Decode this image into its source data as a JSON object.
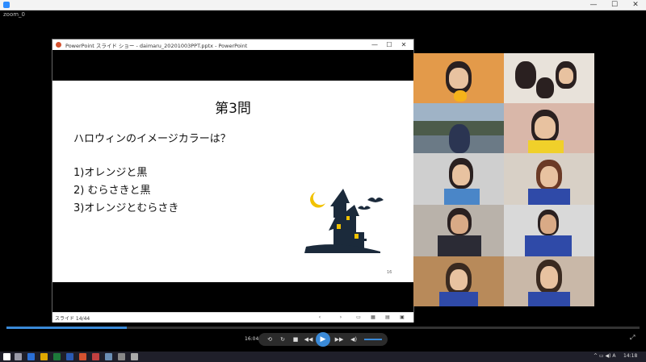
{
  "app": {
    "window_title": "zoom_0",
    "minimize": "—",
    "maximize": "☐",
    "close": "✕"
  },
  "ppt": {
    "title": "PowerPoint スライド ショー  -  daimaru_20201003PPT.pptx - PowerPoint",
    "status": "スライド 14/44"
  },
  "slide": {
    "title": "第3問",
    "question": "ハロウィンのイメージカラーは？",
    "options": [
      "1)オレンジと黒",
      "2) むらさきと黒",
      "3)オレンジとむらさき"
    ],
    "page_number": "16"
  },
  "player": {
    "time": "16:04",
    "progress": 0.19,
    "controls": {
      "repeat": "⟲",
      "rotate": "↻",
      "stop": "■",
      "prev": "◀◀",
      "play": "▶",
      "next": "▶▶",
      "volume": "◀)"
    },
    "fullscreen": "⤢"
  },
  "taskbar": {
    "clock": "14:18",
    "tray": "^ ▭ ◀) A"
  },
  "colors": {
    "accent": "#3a8ad8",
    "ppt_icon": "#d35230"
  }
}
